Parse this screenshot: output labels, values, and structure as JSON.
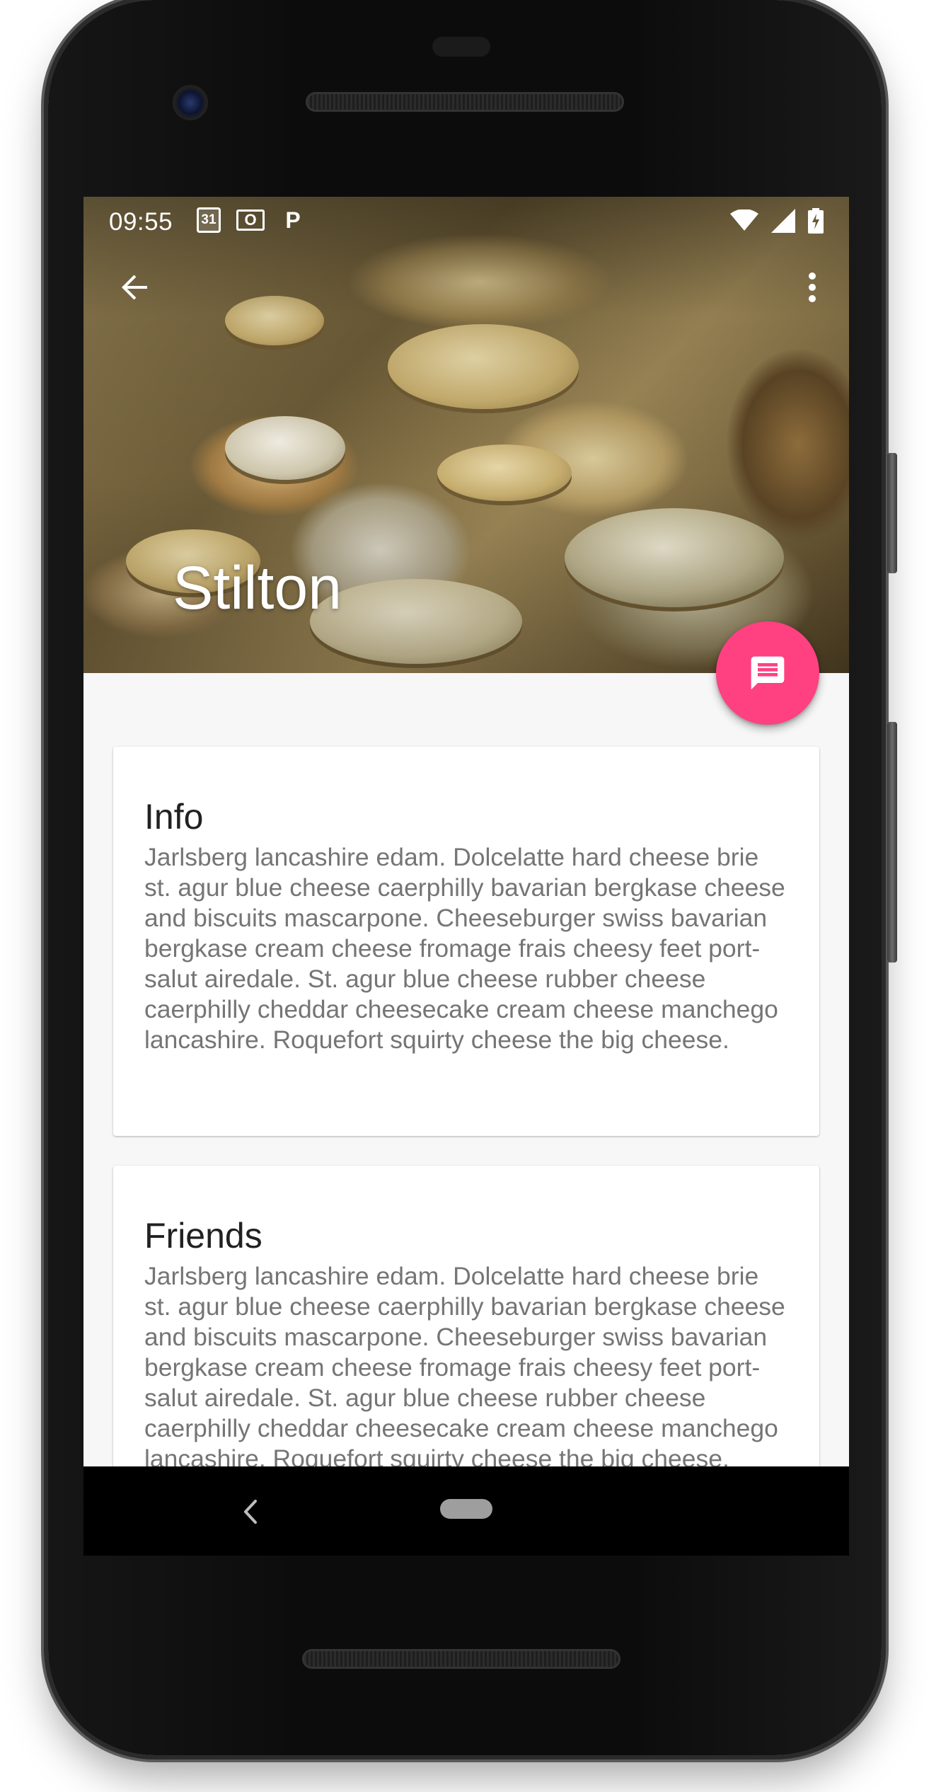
{
  "status_bar": {
    "time": "09:55",
    "icons_left": [
      "calendar-icon",
      "outlook-icon",
      "parking-icon"
    ],
    "calendar_label": "31",
    "outlook_label": "O",
    "parking_label": "P",
    "icons_right": [
      "wifi-icon",
      "signal-icon",
      "battery-charging-icon"
    ]
  },
  "toolbar": {
    "back_icon": "arrow-back-icon",
    "overflow_icon": "more-vert-icon"
  },
  "hero": {
    "title": "Stilton"
  },
  "fab": {
    "icon": "message-icon",
    "color": "#ff4081"
  },
  "cards": {
    "info": {
      "title": "Info",
      "body": "Jarlsberg lancashire edam. Dolcelatte hard cheese brie st. agur blue cheese caerphilly bavarian bergkase cheese and biscuits mascarpone. Cheeseburger swiss bavarian bergkase cream cheese fromage frais cheesy feet port-salut airedale. St. agur blue cheese rubber cheese caerphilly cheddar cheesecake cream cheese manchego lancashire. Roquefort squirty cheese the big cheese."
    },
    "friends": {
      "title": "Friends",
      "body": "Jarlsberg lancashire edam. Dolcelatte hard cheese brie st. agur blue cheese caerphilly bavarian bergkase cheese and biscuits mascarpone. Cheeseburger swiss bavarian bergkase cream cheese fromage frais cheesy feet port-salut airedale. St. agur blue cheese rubber cheese caerphilly cheddar cheesecake cream cheese manchego lancashire. Roquefort squirty cheese the big cheese."
    }
  },
  "nav_bar": {
    "back_icon": "nav-back-icon",
    "home_icon": "nav-home-pill"
  },
  "colors": {
    "accent": "#ff4081",
    "background": "#f7f7f7",
    "card": "#ffffff",
    "title_text": "#212121",
    "body_text": "#757575"
  }
}
